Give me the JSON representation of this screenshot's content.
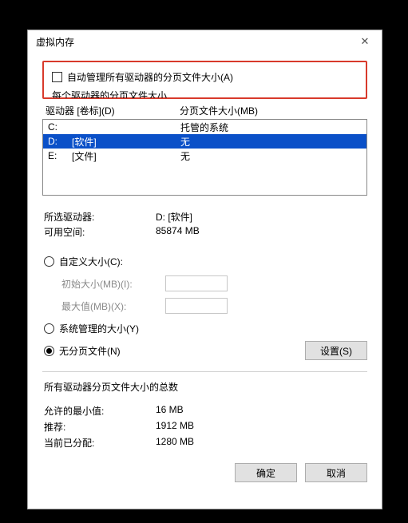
{
  "window": {
    "title": "虚拟内存"
  },
  "auto_manage": {
    "label": "自动管理所有驱动器的分页文件大小(A)",
    "checked": false
  },
  "per_drive_header": "每个驱动器的分页文件大小",
  "list_header": {
    "drive_label": "驱动器 [卷标](D)",
    "paging_size": "分页文件大小(MB)"
  },
  "drives": [
    {
      "letter": "C:",
      "label": "",
      "paging": "托管的系统",
      "selected": false
    },
    {
      "letter": "D:",
      "label": "[软件]",
      "paging": "无",
      "selected": true
    },
    {
      "letter": "E:",
      "label": "[文件]",
      "paging": "无",
      "selected": false
    }
  ],
  "selected_info": {
    "drive_label": "所选驱动器:",
    "drive_value": "D:  [软件]",
    "free_label": "可用空间:",
    "free_value": "85874 MB"
  },
  "radios": {
    "custom": "自定义大小(C):",
    "system": "系统管理的大小(Y)",
    "none": "无分页文件(N)",
    "selected": "none"
  },
  "size_fields": {
    "initial_label": "初始大小(MB)(I):",
    "max_label": "最大值(MB)(X):"
  },
  "set_button": "设置(S)",
  "totals_header": "所有驱动器分页文件大小的总数",
  "totals": {
    "min_label": "允许的最小值:",
    "min_value": "16 MB",
    "rec_label": "推荐:",
    "rec_value": "1912 MB",
    "cur_label": "当前已分配:",
    "cur_value": "1280 MB"
  },
  "buttons": {
    "ok": "确定",
    "cancel": "取消"
  }
}
